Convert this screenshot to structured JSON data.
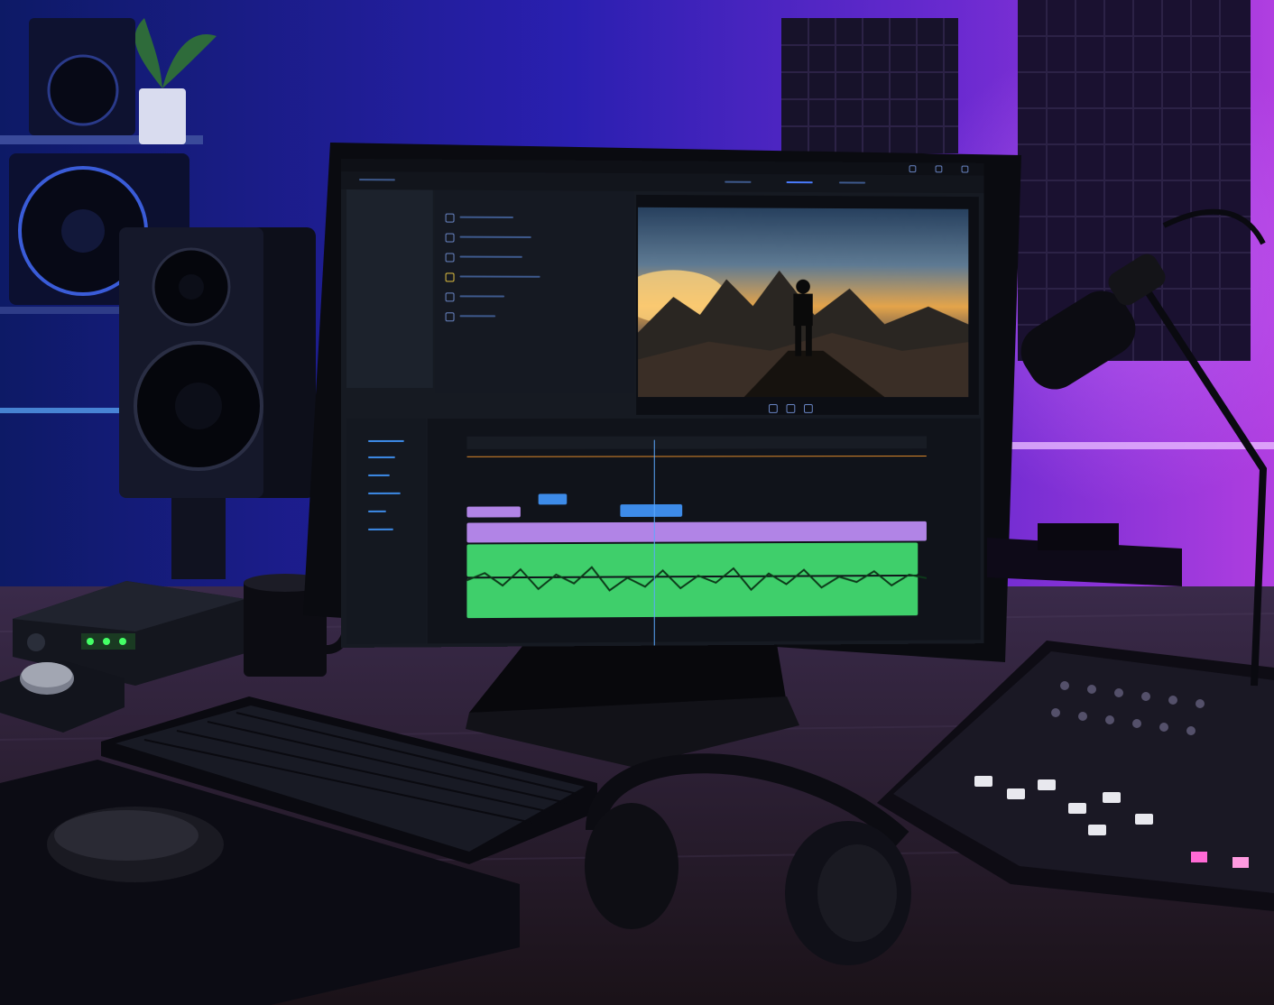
{
  "scene": {
    "description_items": [
      "studio-speakers",
      "monitor",
      "keyboard",
      "mouse",
      "headphones",
      "audio-mixer",
      "microphone",
      "acoustic-panels",
      "audio-interface",
      "mug"
    ]
  },
  "editor": {
    "window_controls": [
      "minimize-icon",
      "maximize-icon",
      "close-icon"
    ],
    "timeline_clip_colors": {
      "video": "#3d8be8",
      "audio_upper": "#b184e6",
      "audio_lower": "#3fcf6b"
    },
    "accent": "#5aa8ff"
  }
}
